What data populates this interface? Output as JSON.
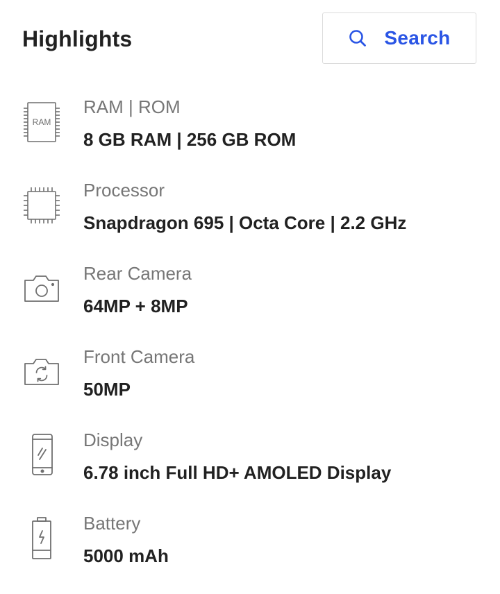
{
  "header": {
    "title": "Highlights",
    "search_label": "Search"
  },
  "colors": {
    "accent": "#2a55e5",
    "label_gray": "#767676",
    "icon_gray": "#6f6f6f",
    "text": "#212121"
  },
  "highlights": [
    {
      "icon": "ram-chip-icon",
      "icon_text": "RAM",
      "label": "RAM | ROM",
      "value": "8 GB RAM | 256 GB ROM"
    },
    {
      "icon": "processor-chip-icon",
      "label": "Processor",
      "value": "Snapdragon 695 | Octa Core | 2.2 GHz"
    },
    {
      "icon": "camera-icon",
      "label": "Rear Camera",
      "value": "64MP + 8MP"
    },
    {
      "icon": "front-camera-icon",
      "label": "Front Camera",
      "value": "50MP"
    },
    {
      "icon": "phone-display-icon",
      "label": "Display",
      "value": "6.78 inch Full HD+ AMOLED Display"
    },
    {
      "icon": "battery-icon",
      "label": "Battery",
      "value": "5000 mAh"
    }
  ]
}
